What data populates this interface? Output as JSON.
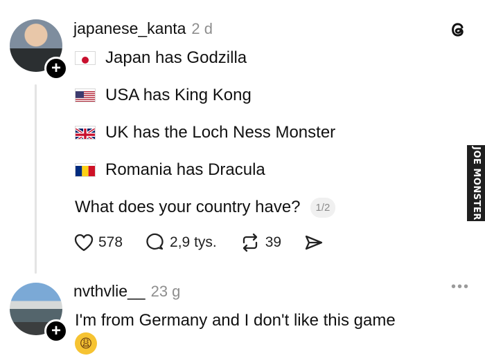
{
  "post": {
    "username": "japanese_kanta",
    "time": "2 d",
    "lines": [
      {
        "flag": "japan",
        "text": "Japan has Godzilla"
      },
      {
        "flag": "usa",
        "text": "USA has King Kong"
      },
      {
        "flag": "uk",
        "text": "UK has the Loch Ness Monster"
      },
      {
        "flag": "romania",
        "text": "Romania has Dracula"
      }
    ],
    "question": "What does your country have?",
    "page_indicator": "1/2",
    "likes": "578",
    "comments": "2,9 tys.",
    "reposts": "39"
  },
  "reply": {
    "username": "nvthvlie__",
    "time": "23 g",
    "text": "I'm from Germany and I don't like this game",
    "emoji": "😩"
  },
  "watermark": "JOE MONSTER",
  "icons": {
    "threads_logo": "threads-logo-icon",
    "like": "heart-icon",
    "comment": "comment-bubble-icon",
    "repost": "repost-icon",
    "share": "send-icon",
    "more": "more-dots-icon",
    "follow": "plus-icon"
  }
}
